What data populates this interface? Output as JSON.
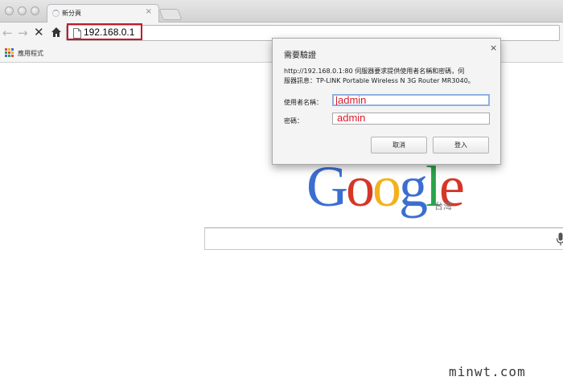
{
  "tab": {
    "title": "新分頁",
    "close_glyph": "×"
  },
  "toolbar": {
    "back_glyph": "←",
    "forward_glyph": "→",
    "stop_glyph": "✕",
    "url": "192.168.0.1"
  },
  "bookmarks": {
    "apps_label": "應用程式"
  },
  "google": {
    "letters": [
      {
        "char": "G",
        "color": "#3b6ed1"
      },
      {
        "char": "o",
        "color": "#d53628"
      },
      {
        "char": "o",
        "color": "#f2b21e"
      },
      {
        "char": "g",
        "color": "#3b6ed1"
      },
      {
        "char": "l",
        "color": "#2aa34a"
      },
      {
        "char": "e",
        "color": "#d53628"
      }
    ],
    "region": "台灣"
  },
  "dialog": {
    "title": "需要驗證",
    "close_glyph": "×",
    "message_line1": "http://192.168.0.1:80 伺服器要求提供使用者名稱和密碼，伺",
    "message_line2": "服器訊息：TP-LINK Portable Wireless N 3G Router MR3040。",
    "username_label": "使用者名稱：",
    "username_value": "admin",
    "password_label": "密碼：",
    "password_value": "admin",
    "cancel_label": "取消",
    "login_label": "登入"
  },
  "watermark": "minwt.com"
}
